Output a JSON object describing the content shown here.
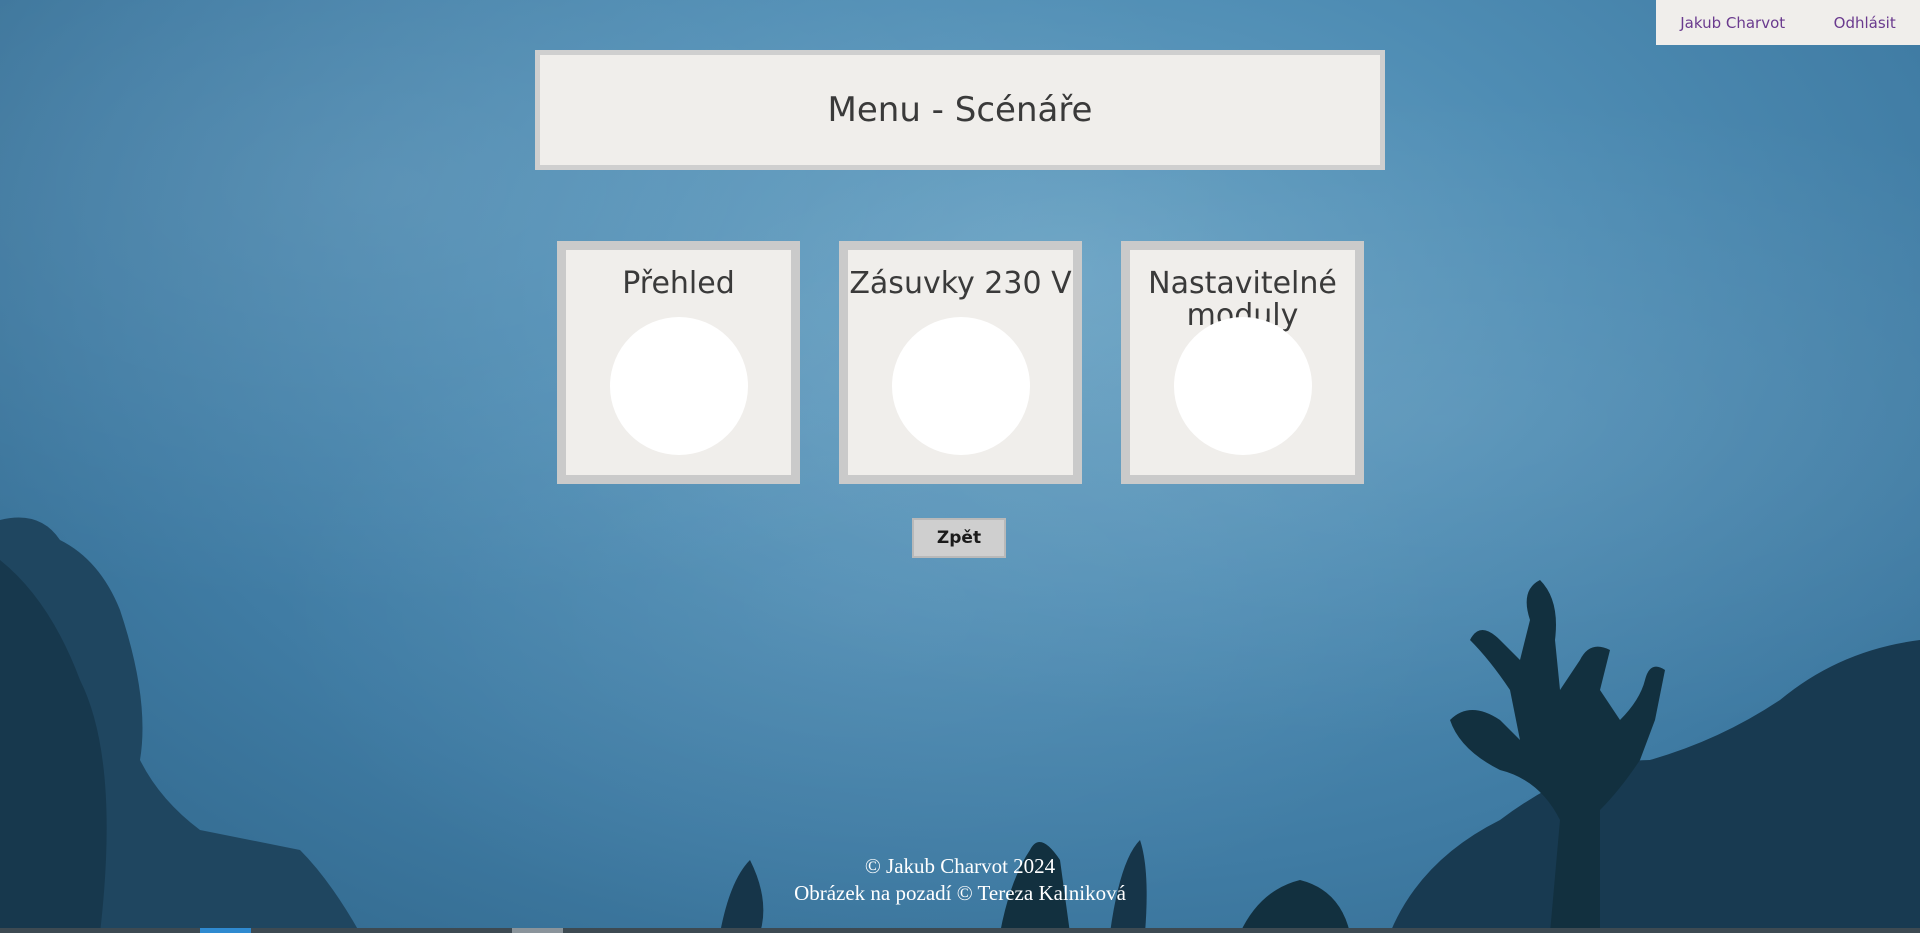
{
  "user_bar": {
    "user_name": "Jakub Charvot",
    "logout_label": "Odhlásit"
  },
  "header": {
    "title": "Menu - Scénáře"
  },
  "tiles": [
    {
      "label": "Přehled"
    },
    {
      "label": "Zásuvky 230 V"
    },
    {
      "label": "Nastavitelné moduly"
    }
  ],
  "back_button": {
    "label": "Zpět"
  },
  "footer": {
    "copyright": "© Jakub Charvot 2024",
    "background_credit": "Obrázek na pozadí © Tereza Kalniková"
  },
  "colors": {
    "panel_background": "#f0eeeb",
    "panel_border": "#cacaca",
    "link_color": "#6a3a8e",
    "text_color": "#3a3a3a"
  }
}
